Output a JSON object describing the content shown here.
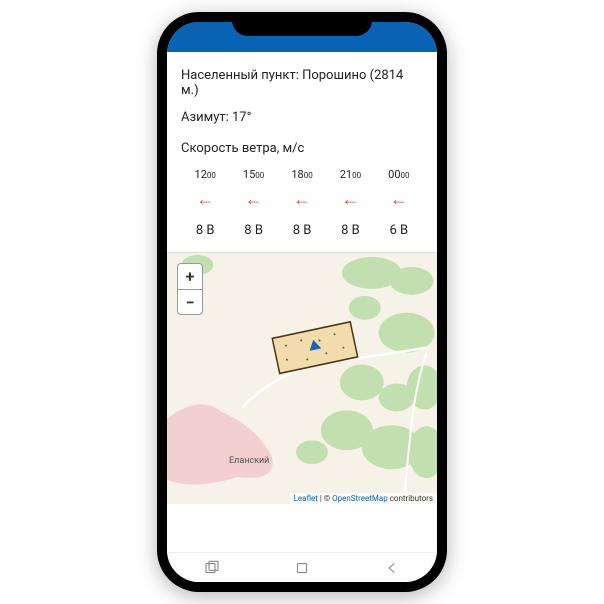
{
  "info": {
    "settlement_label": "Населенный пункт: Порошино (2814 м.)",
    "azimuth_label": "Азимут: 17°"
  },
  "wind": {
    "title": "Скорость ветра, м/с",
    "columns": [
      {
        "time_h": "12",
        "time_m": "00",
        "arrow": "←",
        "speed": "8",
        "dir": "В"
      },
      {
        "time_h": "15",
        "time_m": "00",
        "arrow": "←",
        "speed": "8",
        "dir": "В"
      },
      {
        "time_h": "18",
        "time_m": "00",
        "arrow": "←",
        "speed": "8",
        "dir": "В"
      },
      {
        "time_h": "21",
        "time_m": "00",
        "arrow": "←",
        "speed": "8",
        "dir": "В"
      },
      {
        "time_h": "00",
        "time_m": "00",
        "arrow": "←",
        "speed": "6",
        "dir": "В"
      }
    ]
  },
  "map": {
    "zoom_in": "+",
    "zoom_out": "−",
    "place_label": "Еланский",
    "attribution_leaflet": "Leaflet",
    "attribution_sep": " | © ",
    "attribution_osm": "OpenStreetMap",
    "attribution_tail": " contributors"
  }
}
